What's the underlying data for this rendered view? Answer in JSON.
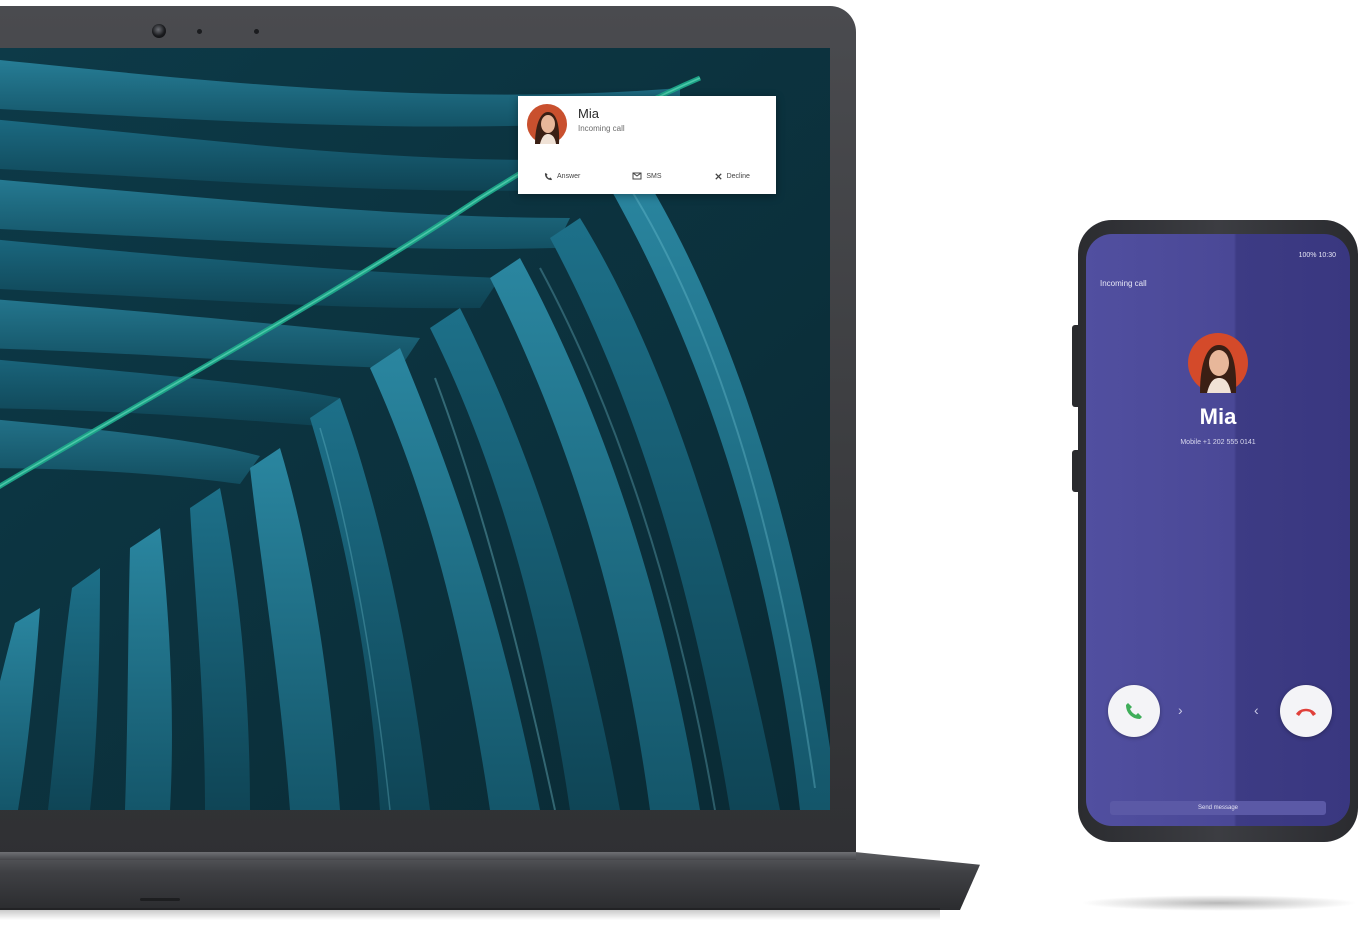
{
  "notification": {
    "name": "Mia",
    "subtitle": "Incoming call",
    "actions": [
      {
        "label": "Answer",
        "icon": "phone-icon"
      },
      {
        "label": "SMS",
        "icon": "message-icon"
      },
      {
        "label": "Decline",
        "icon": "close-icon"
      }
    ]
  },
  "phone": {
    "status_bar": "100% 10:30",
    "header": "Incoming call",
    "caller_name": "Mia",
    "caller_number": "Mobile +1 202 555 0141",
    "answer_icon": "phone-answer-icon",
    "decline_icon": "phone-decline-icon",
    "bottom_bar": "Send message"
  },
  "colors": {
    "screen_teal": "#0e2f38",
    "leaf_blue": "#1f6f86",
    "leaf_green": "#1fa88a",
    "phone_purple": "#4a4896",
    "answer_green": "#3fae5a",
    "decline_red": "#e0403a"
  }
}
